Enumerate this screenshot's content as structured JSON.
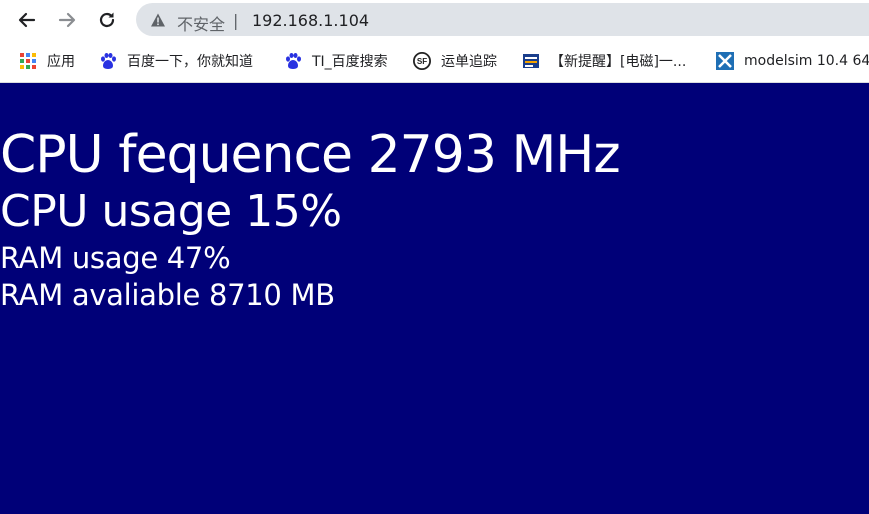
{
  "toolbar": {
    "back_icon": "arrow-left-icon",
    "forward_icon": "arrow-right-icon",
    "reload_icon": "reload-icon",
    "security_icon": "warning-triangle-icon",
    "security_label": "不安全",
    "separator": "|",
    "url": "192.168.1.104"
  },
  "bookmarks": [
    {
      "label": "应用",
      "icon": "apps-grid-icon"
    },
    {
      "label": "百度一下，你就知道",
      "icon": "baidu-paw-icon"
    },
    {
      "label": "TI_百度搜索",
      "icon": "baidu-paw-icon"
    },
    {
      "label": "运单追踪",
      "icon": "sf-logo-icon"
    },
    {
      "label": "【新提醒】[电磁]一...",
      "icon": "site-logo-icon"
    },
    {
      "label": "modelsim 10.4 64",
      "icon": "xilinx-logo-icon"
    }
  ],
  "content": {
    "cpu_frequency": "CPU fequence 2793 MHz",
    "cpu_usage": "CPU usage 15%",
    "ram_usage": "RAM usage 47%",
    "ram_available": "RAM avaliable 8710 MB"
  },
  "colors": {
    "page_background": "#000078",
    "text": "#ffffff",
    "omnibox_background": "#dfe3e8"
  }
}
